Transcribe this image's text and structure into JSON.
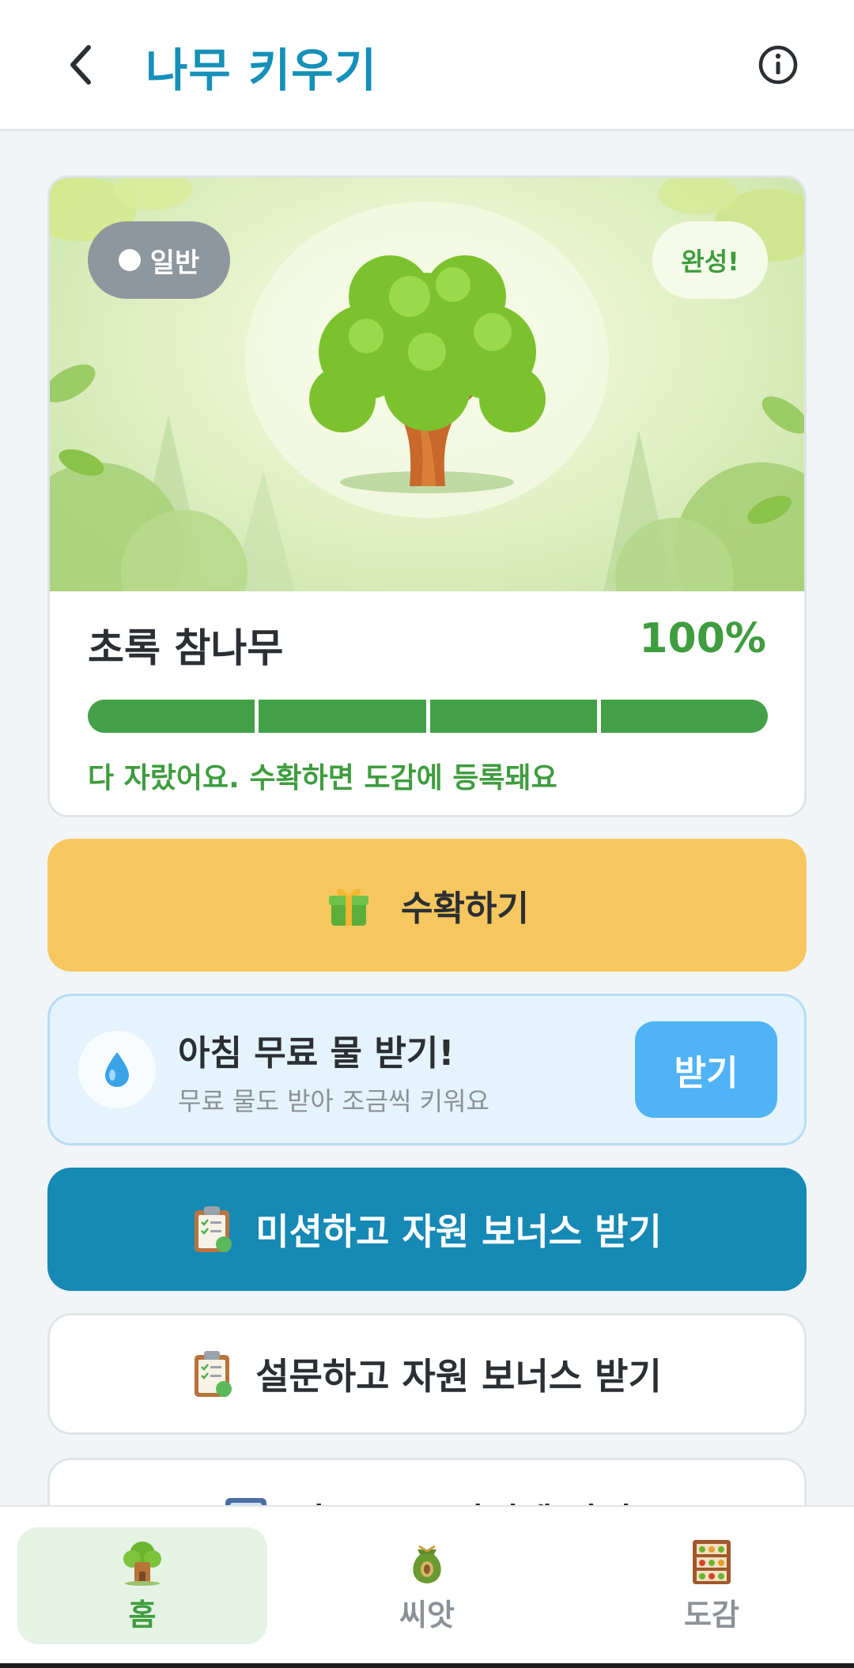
{
  "header": {
    "title": "나무 키우기"
  },
  "tree_card": {
    "grade_label": "일반",
    "complete_badge": "완성!",
    "tree_name": "초록 참나무",
    "growth_percent": "100%",
    "growth_fraction": 1.0,
    "progress_segments": 4,
    "status_message": "다 자랐어요. 수확하면 도감에 등록돼요"
  },
  "harvest": {
    "label": "수확하기",
    "icon": "gift-icon"
  },
  "water_offer": {
    "title": "아침 무료 물 받기!",
    "subtitle": "무료 물도 받아 조금씩 키워요",
    "button_label": "받기",
    "icon": "water-drop-icon"
  },
  "mission": {
    "label": "미션하고 자원 보너스 받기",
    "icon": "clipboard-icon"
  },
  "survey": {
    "label": "설문하고 자원 보너스 받기",
    "icon": "clipboard-icon"
  },
  "partial_card": {
    "label": "광고 보고 아이템 받기",
    "icon": "ad-icon"
  },
  "bottom_nav": {
    "items": [
      {
        "label": "홈",
        "icon": "tree-house-icon",
        "active": true
      },
      {
        "label": "씨앗",
        "icon": "seed-bag-icon",
        "active": false
      },
      {
        "label": "도감",
        "icon": "bookshelf-icon",
        "active": false
      }
    ]
  },
  "colors": {
    "brand_blue": "#1590b8",
    "growth_green": "#43a047",
    "harvest_yellow": "#f6c75f",
    "water_blue": "#4fb3f5",
    "mission_blue": "#1689b5"
  }
}
